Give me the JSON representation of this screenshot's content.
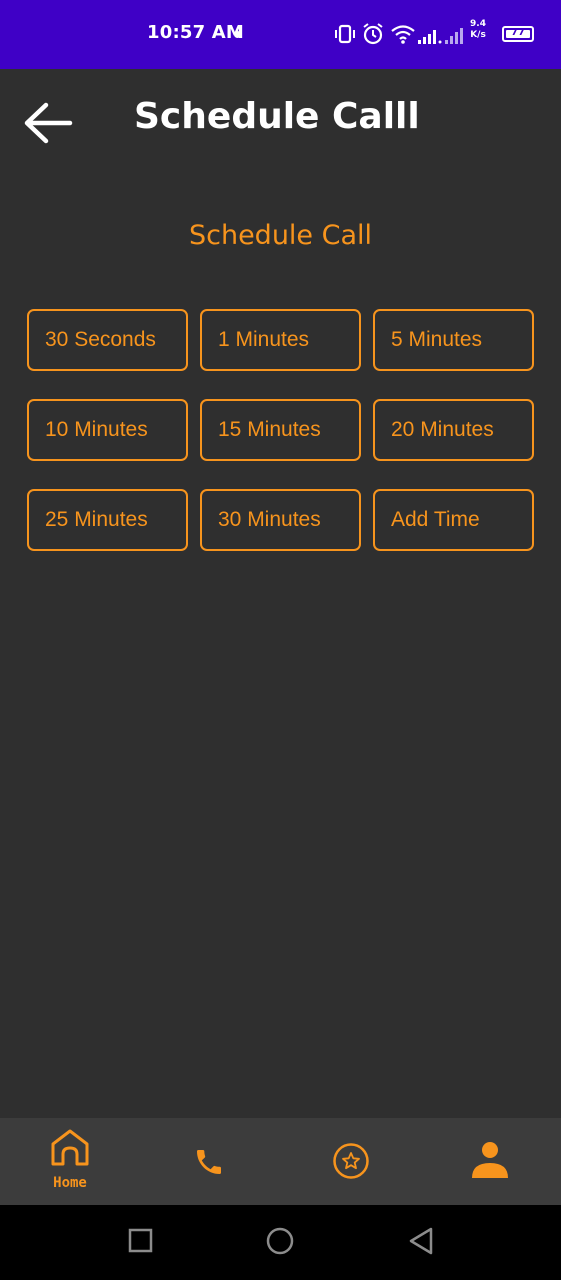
{
  "status_bar": {
    "time": "10:57 AM",
    "net_speed_value": "9.4",
    "net_speed_unit": "K/s",
    "battery": "77",
    "background_color": "#3f00c6"
  },
  "header": {
    "back_icon": "arrow-left-icon",
    "title": "Schedule Calll"
  },
  "main": {
    "section_title": "Schedule Call",
    "accent_color": "#f7941d",
    "options": [
      {
        "label": "30 Seconds"
      },
      {
        "label": "1 Minutes"
      },
      {
        "label": "5 Minutes"
      },
      {
        "label": "10 Minutes"
      },
      {
        "label": "15 Minutes"
      },
      {
        "label": "20 Minutes"
      },
      {
        "label": "25 Minutes"
      },
      {
        "label": "30 Minutes"
      },
      {
        "label": "Add Time"
      }
    ]
  },
  "bottom_nav": {
    "home_label": "Home",
    "items": [
      "home-icon",
      "phone-icon",
      "star-circle-icon",
      "person-icon"
    ]
  },
  "system_nav": {
    "items": [
      "recents-square-icon",
      "home-circle-icon",
      "back-triangle-icon"
    ]
  }
}
